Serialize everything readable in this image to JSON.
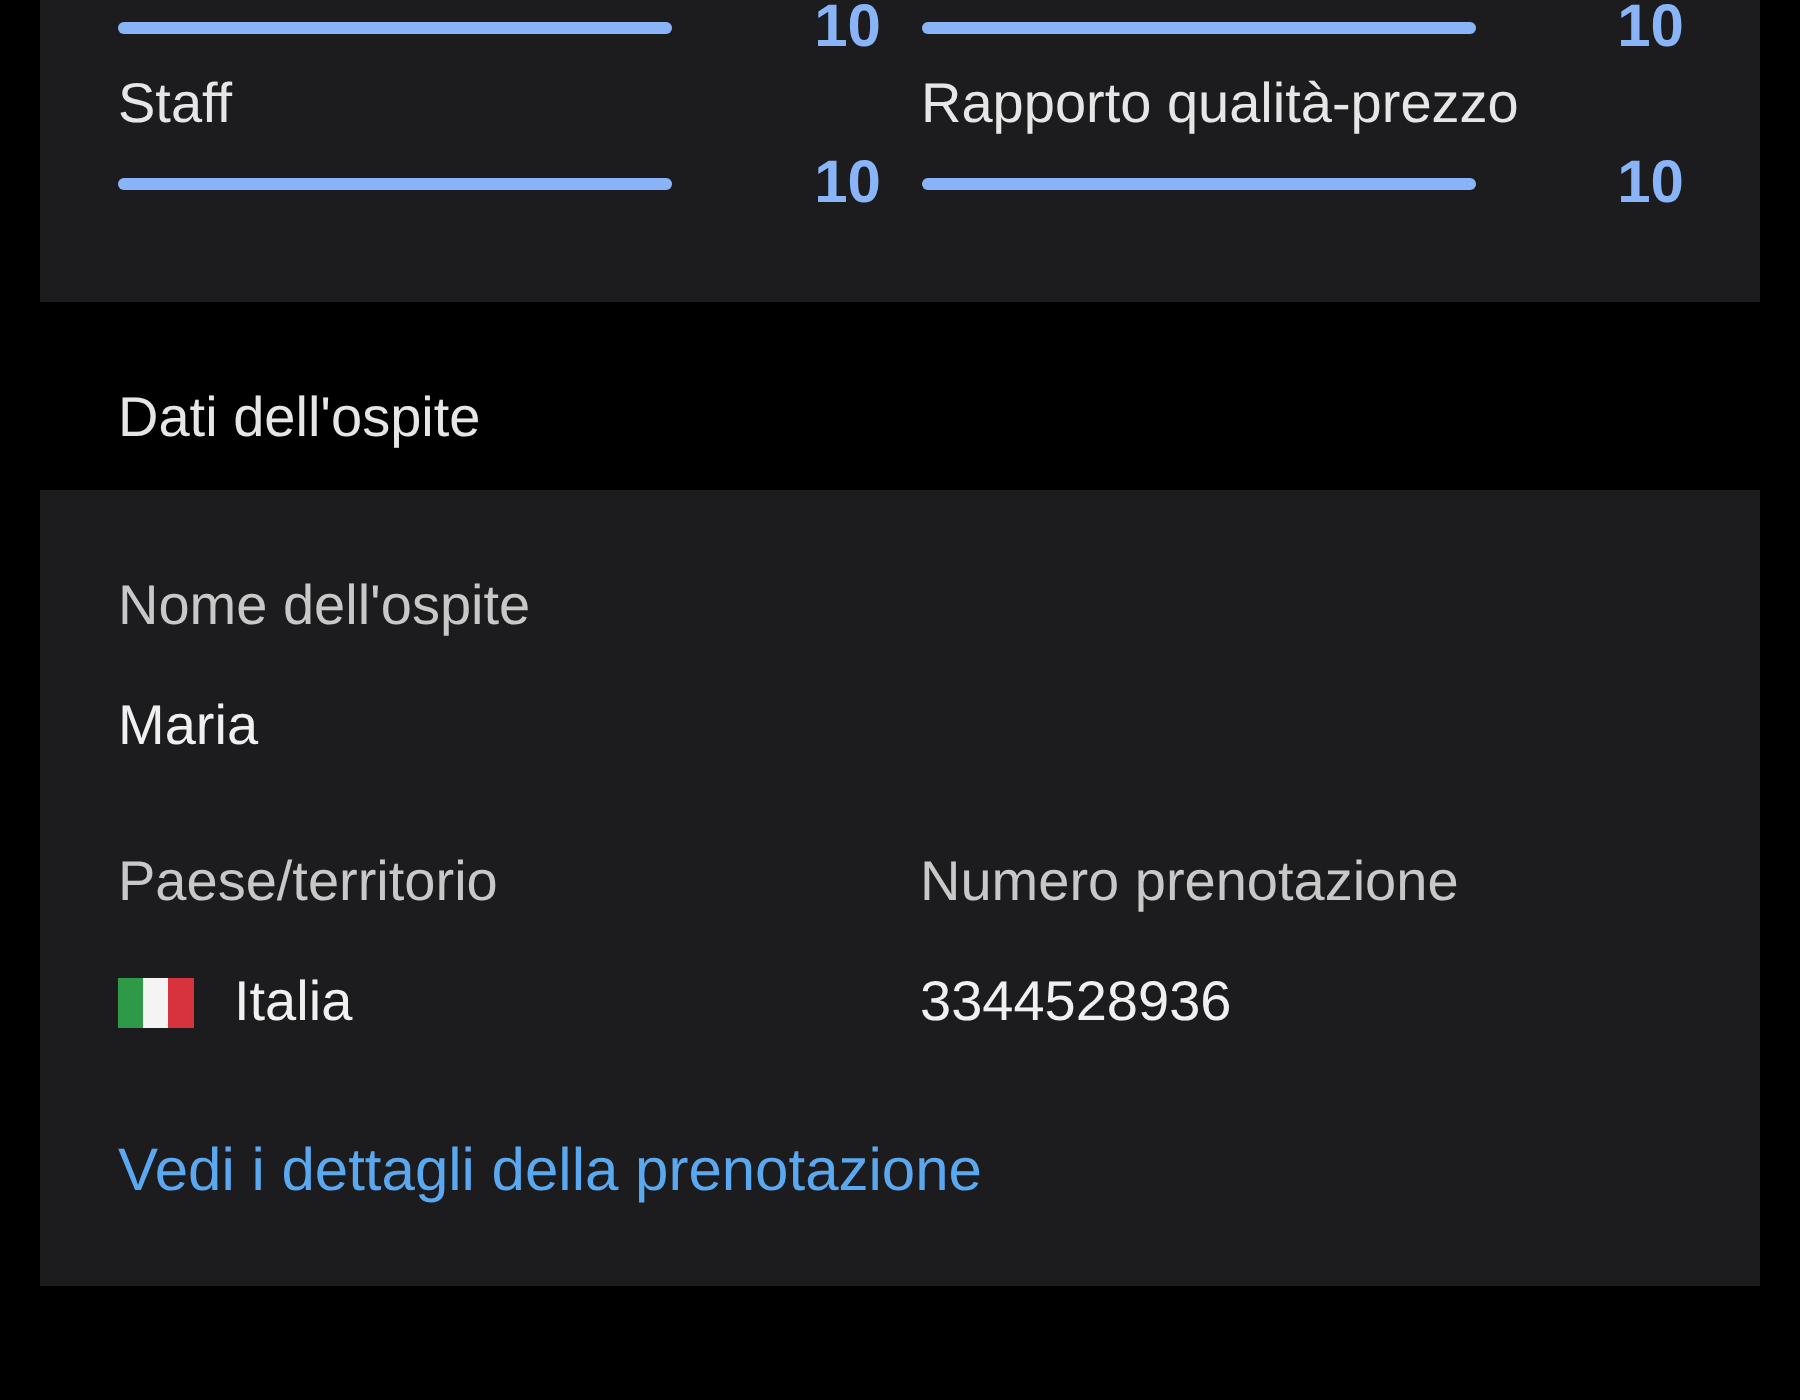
{
  "ratings": [
    {
      "score": "10",
      "level": 1
    },
    {
      "score": "10",
      "level": 1
    },
    {
      "label": "Staff",
      "score": "10",
      "level": 1
    },
    {
      "label": "Rapporto qualità-prezzo",
      "score": "10",
      "level": 1
    }
  ],
  "guest_section": {
    "heading": "Dati dell'ospite",
    "name_label": "Nome dell'ospite",
    "name": "Maria",
    "country_label": "Paese/territorio",
    "country": "Italia",
    "booking_label": "Numero prenotazione",
    "booking_number": "3344528936",
    "link": "Vedi i dettagli della prenotazione"
  }
}
